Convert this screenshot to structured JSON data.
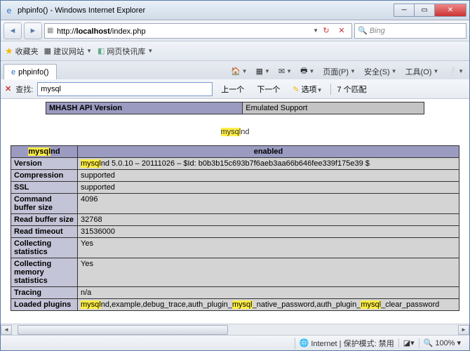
{
  "window": {
    "title": "phpinfo() - Windows Internet Explorer"
  },
  "nav": {
    "url_prefix": "http://",
    "url_host": "localhost",
    "url_path": "/index.php",
    "search_placeholder": "Bing"
  },
  "favbar": {
    "fav": "收藏夹",
    "suggest": "建议网站",
    "quick": "网页快讯库"
  },
  "tab": {
    "label": "phpinfo()"
  },
  "toolbar": {
    "page": "页面(P)",
    "safety": "安全(S)",
    "tools": "工具(O)"
  },
  "findbar": {
    "label": "查找:",
    "value": "mysql",
    "prev": "上一个",
    "next": "下一个",
    "options": "选项",
    "matches": "7 个匹配"
  },
  "topTable": {
    "k": "MHASH API Version",
    "v": "Emulated Support"
  },
  "section": {
    "hl": "mysql",
    "rest": "nd"
  },
  "header": {
    "hl": "mysql",
    "rest": "nd",
    "right": "enabled"
  },
  "rows": [
    {
      "k": "Version",
      "pre": "",
      "hl": "mysql",
      "post": "nd 5.0.10 – 20111026 – $Id: b0b3b15c693b7f6aeb3aa66b646fee339f175e39 $"
    },
    {
      "k": "Compression",
      "v": "supported"
    },
    {
      "k": "SSL",
      "v": "supported"
    },
    {
      "k": "Command buffer size",
      "v": "4096"
    },
    {
      "k": "Read buffer size",
      "v": "32768"
    },
    {
      "k": "Read timeout",
      "v": "31536000"
    },
    {
      "k": "Collecting statistics",
      "v": "Yes"
    },
    {
      "k": "Collecting memory statistics",
      "v": "Yes"
    },
    {
      "k": "Tracing",
      "v": "n/a"
    },
    {
      "k": "Loaded plugins",
      "seg": [
        "mysql",
        "nd,example,debug_trace,auth_plugin_",
        "mysql",
        "_native_password,auth_plugin_",
        "mysql",
        "_clear_password"
      ]
    }
  ],
  "status": {
    "zone": "Internet | 保护模式: 禁用",
    "zoom": "100%"
  }
}
